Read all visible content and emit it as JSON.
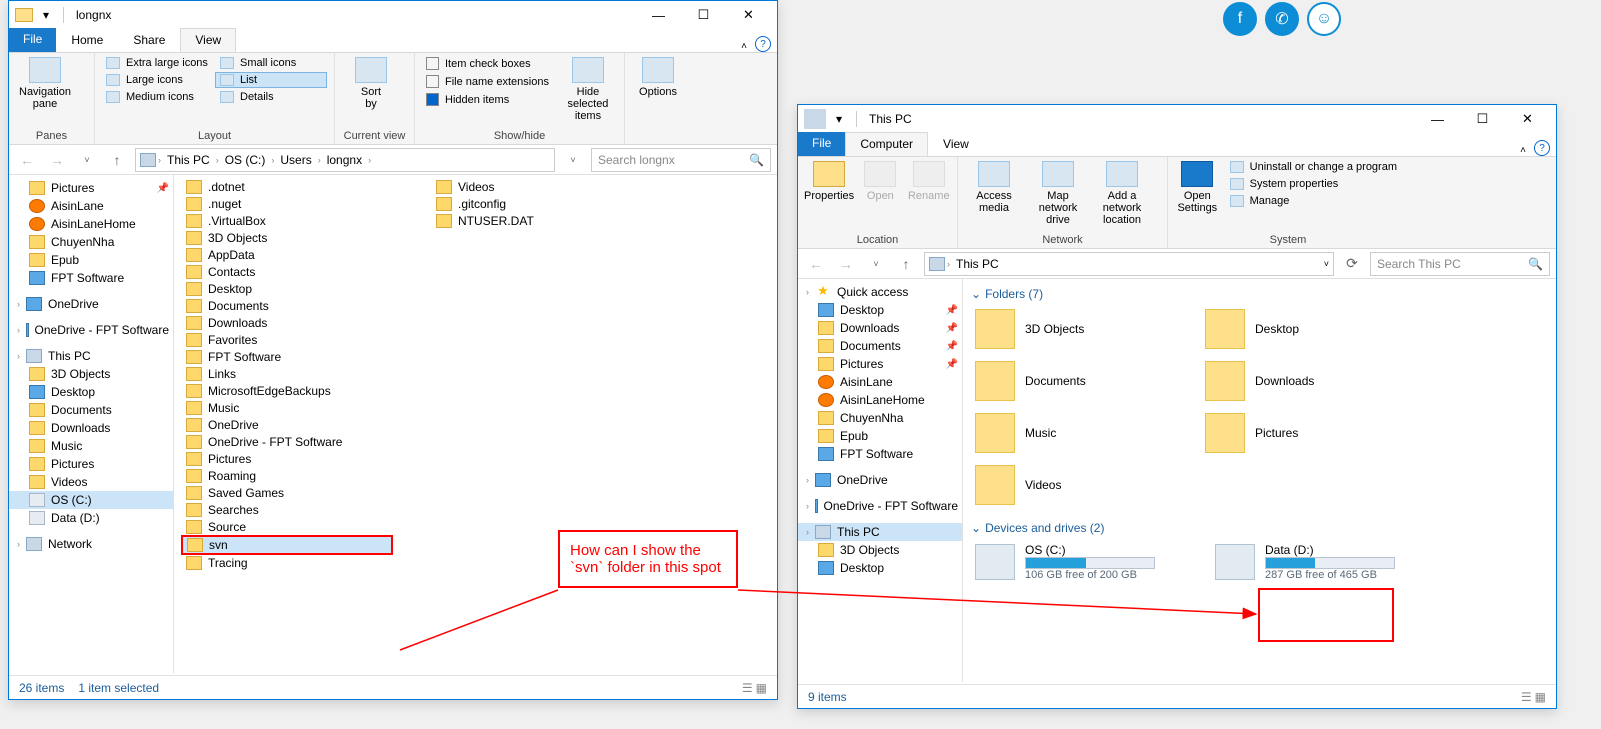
{
  "win1": {
    "title": "longnx",
    "tabs": {
      "file": "File",
      "home": "Home",
      "share": "Share",
      "view": "View"
    },
    "ribbon": {
      "panes_group": "Panes",
      "navpane_label": "Navigation\npane",
      "layout_group": "Layout",
      "layout_items": [
        "Extra large icons",
        "Large icons",
        "Medium icons",
        "Small icons",
        "List",
        "Details"
      ],
      "currentview_group": "Current view",
      "sort_label": "Sort\nby",
      "showhide_group": "Show/hide",
      "check_boxes": "Item check boxes",
      "file_ext": "File name extensions",
      "hidden_items": "Hidden items",
      "hide_selected": "Hide selected\nitems",
      "options_label": "Options"
    },
    "breadcrumbs": [
      "This PC",
      "OS (C:)",
      "Users",
      "longnx"
    ],
    "search_placeholder": "Search longnx",
    "nav_items": [
      {
        "label": "Pictures",
        "icon": "folder",
        "pin": true
      },
      {
        "label": "AisinLane",
        "icon": "orange"
      },
      {
        "label": "AisinLaneHome",
        "icon": "orange"
      },
      {
        "label": "ChuyenNha",
        "icon": "folder"
      },
      {
        "label": "Epub",
        "icon": "folder"
      },
      {
        "label": "FPT Software",
        "icon": "blue"
      },
      {
        "label": "OneDrive",
        "icon": "blue",
        "header": true
      },
      {
        "label": "OneDrive - FPT Software",
        "icon": "blue",
        "header": true
      },
      {
        "label": "This PC",
        "icon": "pc",
        "header": true
      },
      {
        "label": "3D Objects",
        "icon": "folder"
      },
      {
        "label": "Desktop",
        "icon": "blue"
      },
      {
        "label": "Documents",
        "icon": "folder"
      },
      {
        "label": "Downloads",
        "icon": "folder"
      },
      {
        "label": "Music",
        "icon": "folder"
      },
      {
        "label": "Pictures",
        "icon": "folder"
      },
      {
        "label": "Videos",
        "icon": "folder"
      },
      {
        "label": "OS (C:)",
        "icon": "drive",
        "sel": true
      },
      {
        "label": "Data (D:)",
        "icon": "drive"
      },
      {
        "label": "Network",
        "icon": "pc",
        "header": true
      }
    ],
    "files_col1": [
      ".dotnet",
      ".nuget",
      ".VirtualBox",
      "3D Objects",
      "AppData",
      "Contacts",
      "Desktop",
      "Documents",
      "Downloads",
      "Favorites",
      "FPT Software",
      "Links",
      "MicrosoftEdgeBackups",
      "Music",
      "OneDrive",
      "OneDrive - FPT Software",
      "Pictures",
      "Roaming",
      "Saved Games",
      "Searches",
      "Source",
      "svn",
      "Tracing"
    ],
    "files_col2": [
      "Videos",
      ".gitconfig",
      "NTUSER.DAT"
    ],
    "status_items": "26 items",
    "status_sel": "1 item selected"
  },
  "win2": {
    "title": "This PC",
    "tabs": {
      "file": "File",
      "computer": "Computer",
      "view": "View"
    },
    "ribbon": {
      "location_group": "Location",
      "properties": "Properties",
      "open": "Open",
      "rename": "Rename",
      "network_group": "Network",
      "access_media": "Access\nmedia",
      "map_drive": "Map network\ndrive",
      "add_loc": "Add a network\nlocation",
      "system_group": "System",
      "open_settings": "Open\nSettings",
      "uninstall": "Uninstall or change a program",
      "sysprops": "System properties",
      "manage": "Manage"
    },
    "breadcrumb": "This PC",
    "search_placeholder": "Search This PC",
    "nav_items": [
      {
        "label": "Quick access",
        "icon": "star",
        "header": true
      },
      {
        "label": "Desktop",
        "icon": "blue",
        "pin": true
      },
      {
        "label": "Downloads",
        "icon": "folder",
        "pin": true
      },
      {
        "label": "Documents",
        "icon": "folder",
        "pin": true
      },
      {
        "label": "Pictures",
        "icon": "folder",
        "pin": true
      },
      {
        "label": "AisinLane",
        "icon": "orange"
      },
      {
        "label": "AisinLaneHome",
        "icon": "orange"
      },
      {
        "label": "ChuyenNha",
        "icon": "folder"
      },
      {
        "label": "Epub",
        "icon": "folder"
      },
      {
        "label": "FPT Software",
        "icon": "blue"
      },
      {
        "label": "OneDrive",
        "icon": "blue",
        "header": true
      },
      {
        "label": "OneDrive - FPT Software",
        "icon": "blue",
        "header": true
      },
      {
        "label": "This PC",
        "icon": "pc",
        "header": true,
        "sel": true
      },
      {
        "label": "3D Objects",
        "icon": "folder"
      },
      {
        "label": "Desktop",
        "icon": "blue"
      }
    ],
    "folders_header": "Folders (7)",
    "folders": [
      "3D Objects",
      "Desktop",
      "Documents",
      "Downloads",
      "Music",
      "Pictures",
      "Videos"
    ],
    "drives_header": "Devices and drives (2)",
    "drives": [
      {
        "name": "OS (C:)",
        "free": "106 GB free of 200 GB",
        "pct": 47
      },
      {
        "name": "Data (D:)",
        "free": "287 GB free of 465 GB",
        "pct": 38
      }
    ],
    "status_items": "9 items"
  },
  "annotation": {
    "text": "How can I show the `svn` folder in this spot"
  }
}
